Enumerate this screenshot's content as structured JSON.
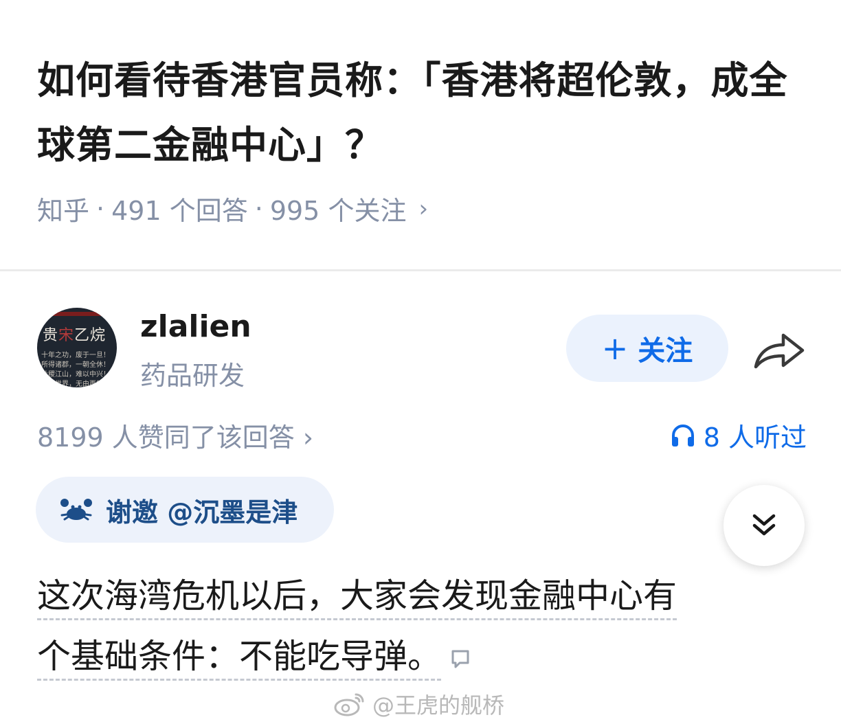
{
  "question": {
    "title": "如何看待香港官员称：「香港将超伦敦，成全球第二金融中心」？",
    "source": "知乎",
    "answers": "491 个回答",
    "followers": "995 个关注",
    "separator": "·"
  },
  "author": {
    "name": "zlalien",
    "bio": "药品研发",
    "avatar_text": "贵宋乙烷",
    "avatar_lines": [
      "十年之功，废于一旦！",
      "所得诸郡，一朝全休！",
      "社稷江山，难以中兴！",
      "乾坤世界，无由再复！"
    ],
    "follow_label": "关注"
  },
  "stats": {
    "likes": "8199 人赞同了该回答",
    "listened": "8 人听过"
  },
  "invite": {
    "label": "谢邀 @沉墨是津"
  },
  "answer": {
    "line1": "这次海湾危机以后，大家会发现金融中心有",
    "line2": "个基础条件：不能吃导弹。"
  },
  "watermark": {
    "text": "@王虎的舰桥"
  },
  "icons": {
    "share": "share-arrow-icon",
    "headphones": "headphones-icon",
    "expand": "double-chevron-down-icon",
    "comment": "comment-bubble-icon",
    "weibo": "weibo-logo-icon",
    "crab": "crab-icon"
  },
  "colors": {
    "accent": "#0f6be8",
    "follow_bg": "#ebf2fd",
    "meta_gray": "#8590a6",
    "invite_bg": "#edf2fb",
    "invite_text": "#1d4e89"
  }
}
